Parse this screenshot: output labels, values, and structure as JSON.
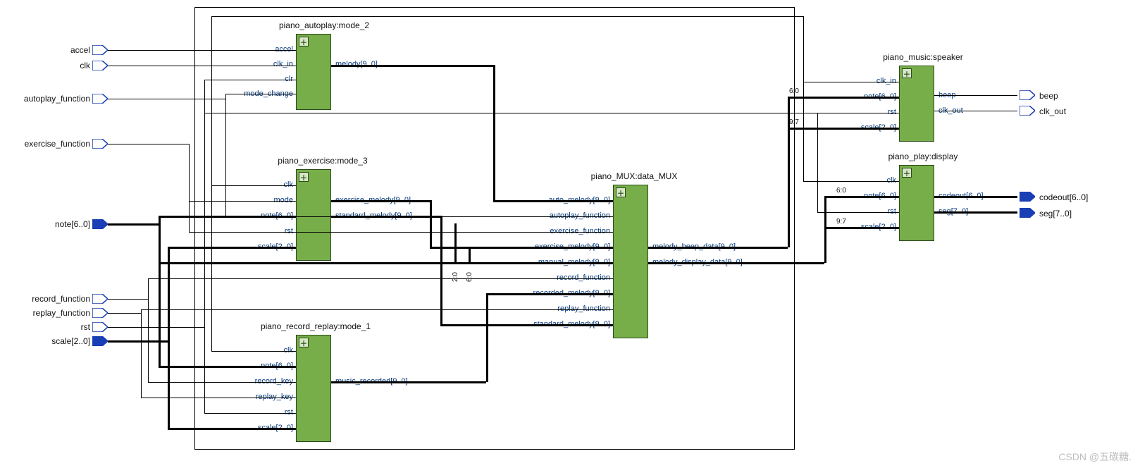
{
  "inputs": {
    "accel": "accel",
    "clk": "clk",
    "autoplay_function": "autoplay_function",
    "exercise_function": "exercise_function",
    "note": "note[6..0]",
    "record_function": "record_function",
    "replay_function": "replay_function",
    "rst": "rst",
    "scale": "scale[2..0]"
  },
  "outputs": {
    "beep": "beep",
    "clk_out": "clk_out",
    "codeout": "codeout[6..0]",
    "seg": "seg[7..0]"
  },
  "blocks": {
    "autoplay": {
      "title": "piano_autoplay:mode_2",
      "in": {
        "accel": "accel",
        "clk_in": "clk_in",
        "clr": "clr",
        "mode_change": "mode_change"
      },
      "out": {
        "melody": "melody[9..0]"
      }
    },
    "exercise": {
      "title": "piano_exercise:mode_3",
      "in": {
        "clk": "clk",
        "mode": "mode",
        "note": "note[6..0]",
        "rst": "rst",
        "scale": "scale[2..0]"
      },
      "out": {
        "exercise_melody": "exercise_melody[9..0]",
        "standard_melody": "standard_melody[9..0]"
      }
    },
    "record": {
      "title": "piano_record_replay:mode_1",
      "in": {
        "clk": "clk",
        "note": "note[6..0]",
        "record_key": "record_key",
        "replay_key": "replay_key",
        "rst": "rst",
        "scale": "scale[2..0]"
      },
      "out": {
        "music_recorded": "music_recorded[9..0]"
      }
    },
    "mux": {
      "title": "piano_MUX:data_MUX",
      "in": {
        "auto_melody": "auto_melody[9..0]",
        "autoplay_function": "autoplay_function",
        "exercise_function": "exercise_function",
        "exercise_melody": "exercise_melody[9..0]",
        "manual_melody": "manual_melody[9..0]",
        "record_function": "record_function",
        "recorded_melody": "recorded_melody[9..0]",
        "replay_function": "replay_function",
        "standard_melody": "standard_melody[9..0]"
      },
      "out": {
        "melody_beep_data": "melody_beep_data[9..0]",
        "melody_display_data": "melody_display_data[9..0]"
      }
    },
    "speaker": {
      "title": "piano_music:speaker",
      "in": {
        "clk_in": "clk_in",
        "note": "note[6..0]",
        "rst": "rst",
        "scale": "scale[2..0]"
      },
      "out": {
        "beep": "beep",
        "clk_out": "clk_out"
      }
    },
    "display": {
      "title": "piano_play:display",
      "in": {
        "clk": "clk",
        "note": "note[6..0]",
        "rst": "rst",
        "scale": "scale[2..0]"
      },
      "out": {
        "codeout": "codeout[6..0]",
        "seg": "seg[7..0]"
      }
    }
  },
  "bus_labels": {
    "b60a": "6:0",
    "b97a": "9:7",
    "b60b": "6:0",
    "b97b": "9:7",
    "b20": "2:0",
    "b60c": "6:0"
  },
  "watermark": "CSDN @五碳糖."
}
